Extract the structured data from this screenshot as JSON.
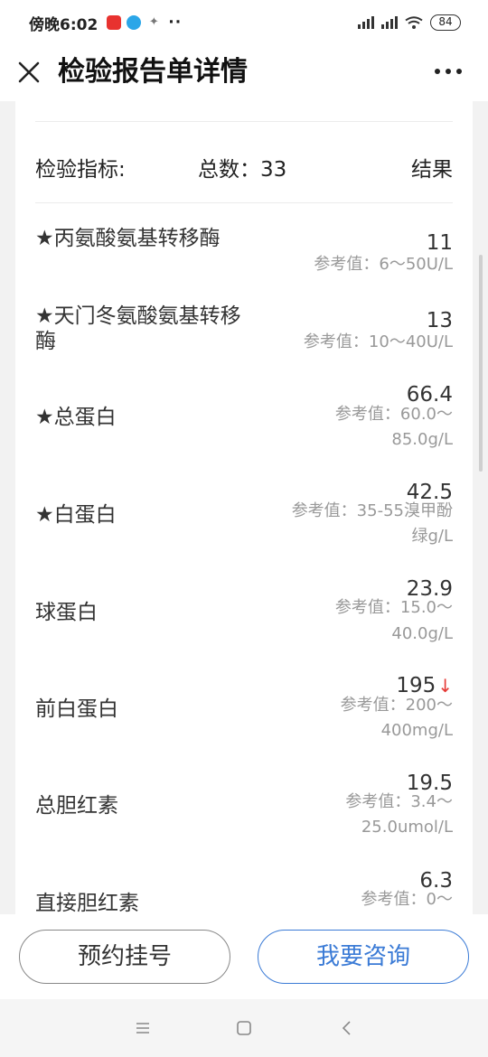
{
  "status": {
    "time": "傍晚6:02",
    "more": "··",
    "battery": "84"
  },
  "header": {
    "title": "检验报告单详情"
  },
  "summary": {
    "label": "检验指标:",
    "total": "总数：33",
    "result": "结果"
  },
  "items": [
    {
      "name": "★丙氨酸氨基转移酶",
      "value": "11",
      "ref": "参考值：6～50U/L"
    },
    {
      "name": "★天门冬氨酸氨基转移酶",
      "value": "13",
      "ref": "参考值：10～40U/L"
    },
    {
      "name": "★总蛋白",
      "value": "66.4",
      "ref1": "参考值：60.0～",
      "ref2": "85.0g/L"
    },
    {
      "name": "★白蛋白",
      "value": "42.5",
      "ref1": "参考值：35-55溴甲酚",
      "ref2": "绿g/L"
    },
    {
      "name": "球蛋白",
      "value": "23.9",
      "ref1": "参考值：15.0～",
      "ref2": "40.0g/L"
    },
    {
      "name": "前白蛋白",
      "value": "195",
      "flag": "↓",
      "ref1": "参考值：200～",
      "ref2": "400mg/L"
    },
    {
      "name": "总胆红素",
      "value": "19.5",
      "ref1": "参考值：3.4～",
      "ref2": "25.0umol/L"
    },
    {
      "name": "直接胆红素",
      "value": "6.3",
      "ref1": "参考值：0～"
    }
  ],
  "buttons": {
    "book": "预约挂号",
    "consult": "我要咨询"
  },
  "colors": {
    "accent": "#3b7bd6",
    "alert": "#e53935"
  }
}
